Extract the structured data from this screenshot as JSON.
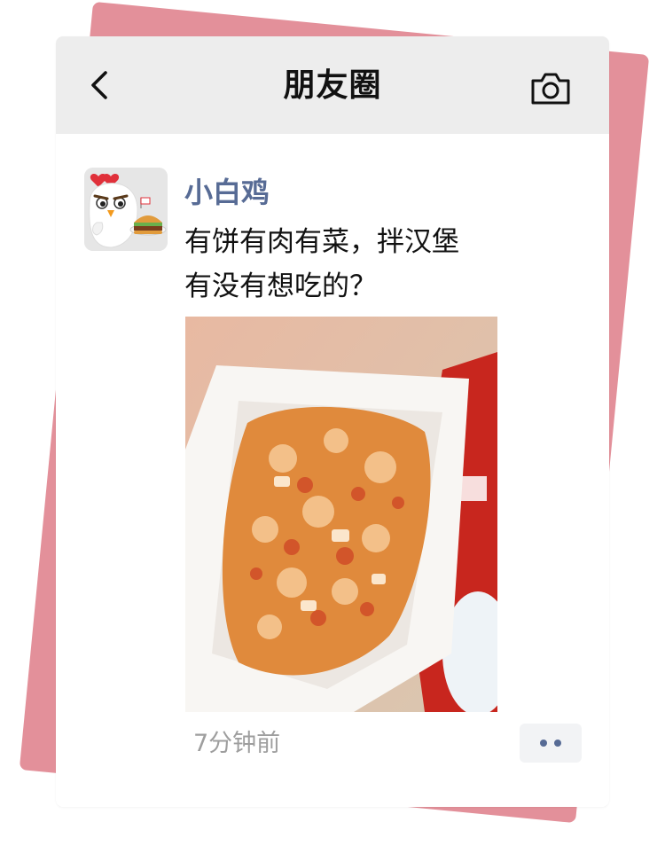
{
  "header": {
    "title": "朋友圈",
    "back_icon": "chevron-left-icon",
    "camera_icon": "camera-icon"
  },
  "post": {
    "author": "小白鸡",
    "text_line1": "有饼有肉有菜，拌汉堡",
    "text_line2": "有没有想吃的？",
    "time": "7分钟前",
    "more_icon": "more-dots-icon"
  },
  "colors": {
    "back_card": "#e3909a",
    "nav_bg": "#ededed",
    "author": "#576b95",
    "time": "#9e9e9e"
  }
}
